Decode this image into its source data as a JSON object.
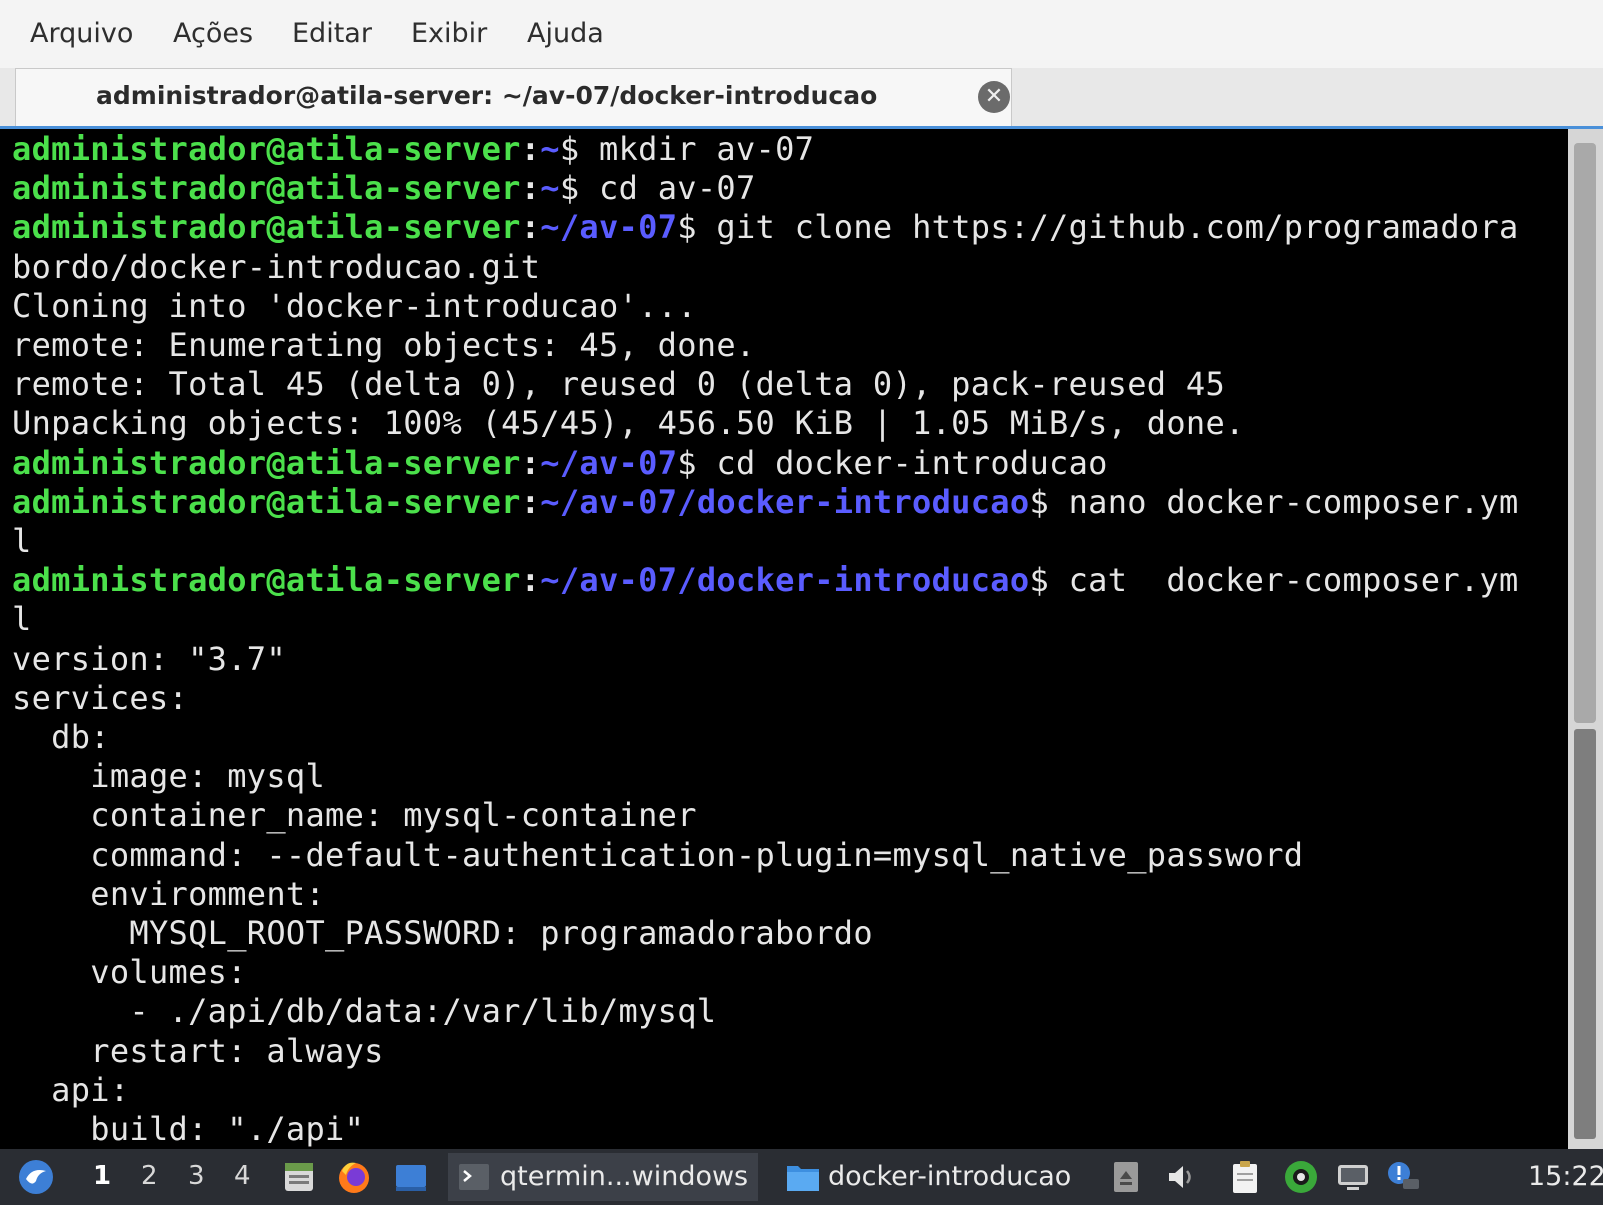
{
  "menubar": {
    "items": [
      "Arquivo",
      "Ações",
      "Editar",
      "Exibir",
      "Ajuda"
    ]
  },
  "tab": {
    "title": "administrador@atila-server: ~/av-07/docker-introducao",
    "close_glyph": "✕"
  },
  "terminal": {
    "prompt_user": "administrador@atila-server",
    "lines": [
      {
        "kind": "prompt",
        "path": "~",
        "cmd": " mkdir av-07"
      },
      {
        "kind": "prompt",
        "path": "~",
        "cmd": " cd av-07"
      },
      {
        "kind": "prompt",
        "path": "~/av-07",
        "cmd": " git clone https://github.com/programadora"
      },
      {
        "kind": "out",
        "text": "bordo/docker-introducao.git"
      },
      {
        "kind": "out",
        "text": "Cloning into 'docker-introducao'..."
      },
      {
        "kind": "out",
        "text": "remote: Enumerating objects: 45, done."
      },
      {
        "kind": "out",
        "text": "remote: Total 45 (delta 0), reused 0 (delta 0), pack-reused 45"
      },
      {
        "kind": "out",
        "text": "Unpacking objects: 100% (45/45), 456.50 KiB | 1.05 MiB/s, done."
      },
      {
        "kind": "prompt",
        "path": "~/av-07",
        "cmd": " cd docker-introducao"
      },
      {
        "kind": "prompt",
        "path": "~/av-07/docker-introducao",
        "cmd": " nano docker-composer.ym"
      },
      {
        "kind": "out",
        "text": "l"
      },
      {
        "kind": "prompt",
        "path": "~/av-07/docker-introducao",
        "cmd": " cat  docker-composer.ym"
      },
      {
        "kind": "out",
        "text": "l"
      },
      {
        "kind": "out",
        "text": "version: \"3.7\""
      },
      {
        "kind": "out",
        "text": "services:"
      },
      {
        "kind": "out",
        "text": "  db:"
      },
      {
        "kind": "out",
        "text": "    image: mysql"
      },
      {
        "kind": "out",
        "text": "    container_name: mysql-container"
      },
      {
        "kind": "out",
        "text": "    command: --default-authentication-plugin=mysql_native_password"
      },
      {
        "kind": "out",
        "text": "    enviromment:"
      },
      {
        "kind": "out",
        "text": "      MYSQL_ROOT_PASSWORD: programadorabordo"
      },
      {
        "kind": "out",
        "text": "    volumes:"
      },
      {
        "kind": "out",
        "text": "      - ./api/db/data:/var/lib/mysql"
      },
      {
        "kind": "out",
        "text": "    restart: always"
      },
      {
        "kind": "out",
        "text": "  api:"
      },
      {
        "kind": "out",
        "text": "    build: \"./api\""
      }
    ]
  },
  "taskbar": {
    "workspaces": [
      "1",
      "2",
      "3",
      "4"
    ],
    "windows": [
      {
        "label": "qtermin...windows",
        "icon": "terminal-icon"
      },
      {
        "label": "docker-introducao",
        "icon": "folder-icon"
      }
    ],
    "clock": "15:22"
  },
  "colors": {
    "prompt_user": "#4be04b",
    "prompt_path": "#5a5cff",
    "terminal_bg": "#000000",
    "terminal_fg": "#e6e6e6",
    "taskbar_bg": "#2a2d33",
    "accent": "#4a90d9"
  }
}
